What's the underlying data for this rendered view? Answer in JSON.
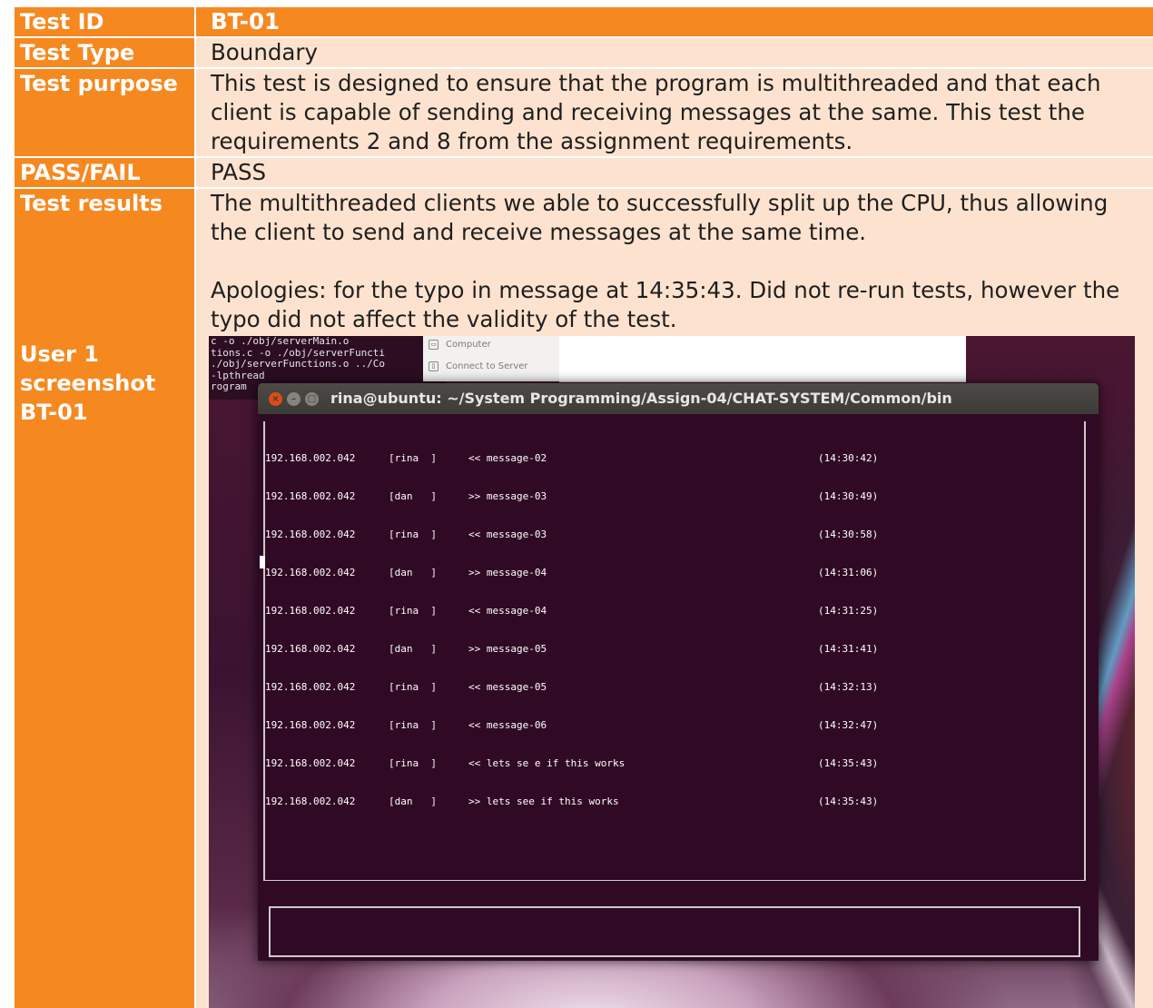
{
  "document": {
    "test_id": {
      "label": "Test ID",
      "value": "BT-01"
    },
    "test_type": {
      "label": "Test Type",
      "value": "Boundary"
    },
    "test_purpose": {
      "label": "Test purpose",
      "value": "This test is designed to ensure that the program is multithreaded and that each client is capable of sending and receiving messages at the same. This test the requirements 2 and 8 from the assignment requirements."
    },
    "pass_fail": {
      "label": "PASS/FAIL",
      "value": "PASS"
    },
    "test_results": {
      "label": "Test results",
      "paragraph_1": "The multithreaded clients we able to successfully split up the CPU, thus allowing the client to send and receive messages at the same time.",
      "paragraph_2": "Apologies: for the typo in message at 14:35:43. Did not re-run tests, however the typo did not affect the validity of the test."
    },
    "screenshot": {
      "label": "User 1 screenshot BT-01"
    }
  },
  "desktop": {
    "background_terminal_text": "c -o ./obj/serverMain.o\ntions.c -o ./obj/serverFuncti\n./obj/serverFunctions.o ../Co\n-lpthread\nrogram",
    "file_menu": [
      {
        "label": "Computer",
        "icon": "computer-icon"
      },
      {
        "label": "Connect to Server",
        "icon": "server-icon"
      }
    ]
  },
  "terminal": {
    "title": "rina@ubuntu: ~/System Programming/Assign-04/CHAT-SYSTEM/Common/bin",
    "window_buttons": {
      "close": "×",
      "minimize": "–",
      "maximize": "□"
    },
    "messages": [
      {
        "ip": "192.168.002.042",
        "user": "[rina  ]",
        "text": "<< message-02",
        "time": "(14:30:42)"
      },
      {
        "ip": "192.168.002.042",
        "user": "[dan   ]",
        "text": ">> message-03",
        "time": "(14:30:49)"
      },
      {
        "ip": "192.168.002.042",
        "user": "[rina  ]",
        "text": "<< message-03",
        "time": "(14:30:58)"
      },
      {
        "ip": "192.168.002.042",
        "user": "[dan   ]",
        "text": ">> message-04",
        "time": "(14:31:06)"
      },
      {
        "ip": "192.168.002.042",
        "user": "[rina  ]",
        "text": "<< message-04",
        "time": "(14:31:25)"
      },
      {
        "ip": "192.168.002.042",
        "user": "[dan   ]",
        "text": ">> message-05",
        "time": "(14:31:41)"
      },
      {
        "ip": "192.168.002.042",
        "user": "[rina  ]",
        "text": "<< message-05",
        "time": "(14:32:13)"
      },
      {
        "ip": "192.168.002.042",
        "user": "[rina  ]",
        "text": "<< message-06",
        "time": "(14:32:47)"
      },
      {
        "ip": "192.168.002.042",
        "user": "[rina  ]",
        "text": "<< lets se e if this works",
        "time": "(14:35:43)"
      },
      {
        "ip": "192.168.002.042",
        "user": "[dan   ]",
        "text": ">> lets see if this works",
        "time": "(14:35:43)"
      }
    ],
    "input_value": ""
  },
  "colors": {
    "accent": "#f68820",
    "light_row": "#fde3cf",
    "terminal_bg": "#300a24"
  }
}
